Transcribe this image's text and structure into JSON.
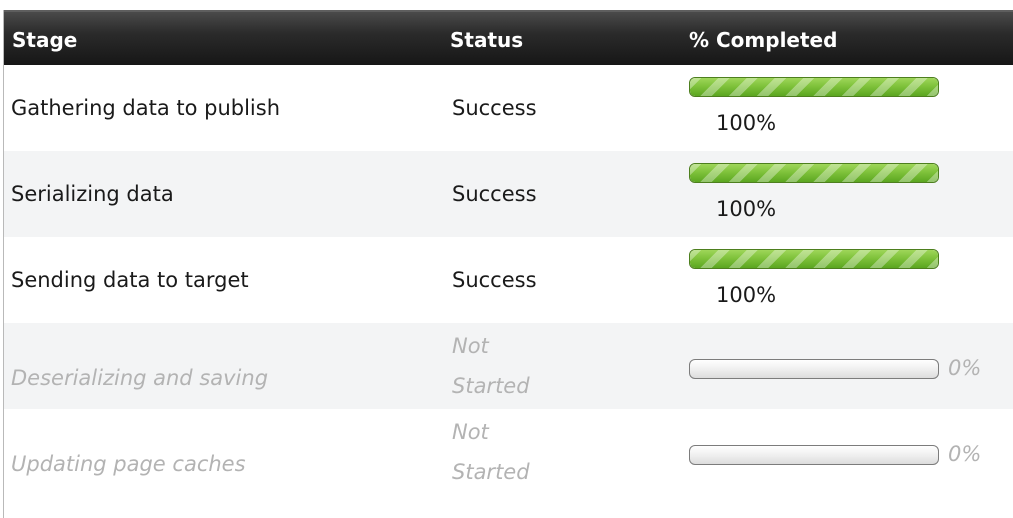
{
  "table": {
    "columns": {
      "stage": "Stage",
      "status": "Status",
      "percent": "% Completed"
    },
    "rows": [
      {
        "stage": "Gathering data to publish",
        "status": "Success",
        "percent_text": "100%",
        "progress": 1.0
      },
      {
        "stage": "Serializing data",
        "status": "Success",
        "percent_text": "100%",
        "progress": 1.0
      },
      {
        "stage": "Sending data to target",
        "status": "Success",
        "percent_text": "100%",
        "progress": 1.0
      },
      {
        "stage": "Deserializing and saving",
        "status_line1": "Not",
        "status_line2": "Started",
        "percent_text": "0%",
        "progress": 0.0
      },
      {
        "stage": "Updating page caches",
        "status_line1": "Not",
        "status_line2": "Started",
        "percent_text": "0%",
        "progress": 0.0
      }
    ]
  },
  "colors": {
    "header_bg": "#161616",
    "progress_fill": "#7fc23b",
    "alt_row_bg": "#f3f4f5",
    "pending_text": "#b3b3b3"
  }
}
